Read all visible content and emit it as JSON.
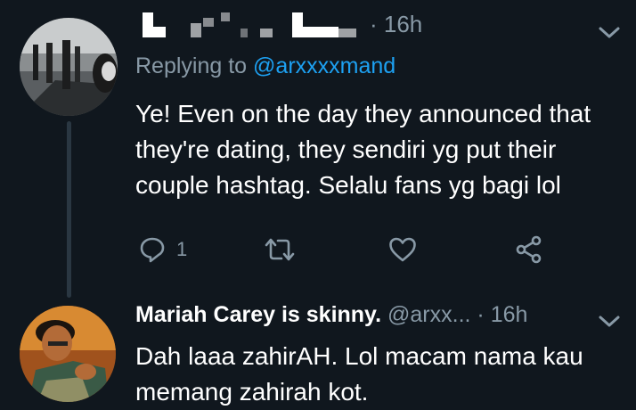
{
  "tweet1": {
    "time": "· 16h",
    "replying_prefix": "Replying to ",
    "replying_handle": "@arxxxxmand",
    "text": "Ye! Even on the day they announced that they're dating, they sendiri yg put their couple hashtag. Selalu fans yg bagi lol",
    "reply_count": "1",
    "icons": [
      "reply-icon",
      "retweet-icon",
      "like-icon",
      "share-icon",
      "chevron-down-icon"
    ]
  },
  "tweet2": {
    "name": "Mariah Carey is skinny.",
    "handle": "@arxx...",
    "time": "· 16h",
    "text": "Dah laaa zahirAH. Lol macam nama kau memang zahirah kot."
  },
  "colors": {
    "background": "#10171e",
    "secondary_text": "#8899a6",
    "link": "#1da1f2",
    "primary_text": "#ffffff"
  }
}
